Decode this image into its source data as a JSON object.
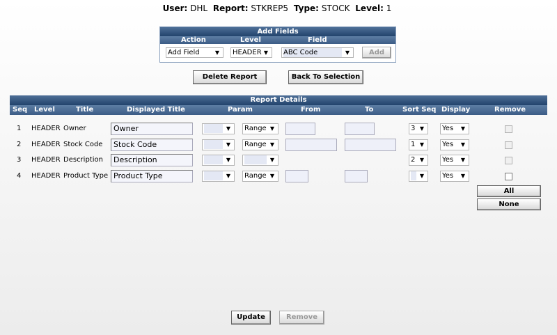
{
  "info": {
    "user_label": "User:",
    "user": "DHL",
    "report_label": "Report:",
    "report": "STKREP5",
    "type_label": "Type:",
    "type": "STOCK",
    "level_label": "Level:",
    "level": "1"
  },
  "add_fields": {
    "title": "Add Fields",
    "col_action": "Action",
    "col_level": "Level",
    "col_field": "Field",
    "action_value": "Add Field",
    "level_value": "HEADER",
    "field_value": "ABC Code",
    "add_label": "Add"
  },
  "buttons": {
    "delete_report": "Delete Report",
    "back_to_selection": "Back To Selection",
    "all": "All",
    "none": "None",
    "update": "Update",
    "remove": "Remove"
  },
  "report_details": {
    "title": "Report Details",
    "headers": {
      "seq": "Seq",
      "level": "Level",
      "title": "Title",
      "displayed_title": "Displayed Title",
      "param": "Param",
      "from": "From",
      "to": "To",
      "sort_seq": "Sort Seq",
      "display": "Display",
      "remove": "Remove"
    },
    "rows": [
      {
        "seq": "1",
        "level": "HEADER",
        "title": "Owner",
        "displayed_title": "Owner",
        "param1": "",
        "param2": "Range",
        "sort_seq": "3",
        "display": "Yes"
      },
      {
        "seq": "2",
        "level": "HEADER",
        "title": "Stock Code",
        "displayed_title": "Stock Code",
        "param1": "",
        "param2": "Range",
        "sort_seq": "1",
        "display": "Yes"
      },
      {
        "seq": "3",
        "level": "HEADER",
        "title": "Description",
        "displayed_title": "Description",
        "param1": "",
        "param2": "",
        "sort_seq": "2",
        "display": "Yes"
      },
      {
        "seq": "4",
        "level": "HEADER",
        "title": "Product Type",
        "displayed_title": "Product Type",
        "param1": "",
        "param2": "Range",
        "sort_seq": "",
        "display": "Yes"
      }
    ]
  },
  "icons": {
    "dropdown": "▼"
  },
  "colors": {
    "header_dark": "#22436c",
    "header_light": "#4e6f97",
    "field_shade": "#e4e8f4"
  }
}
